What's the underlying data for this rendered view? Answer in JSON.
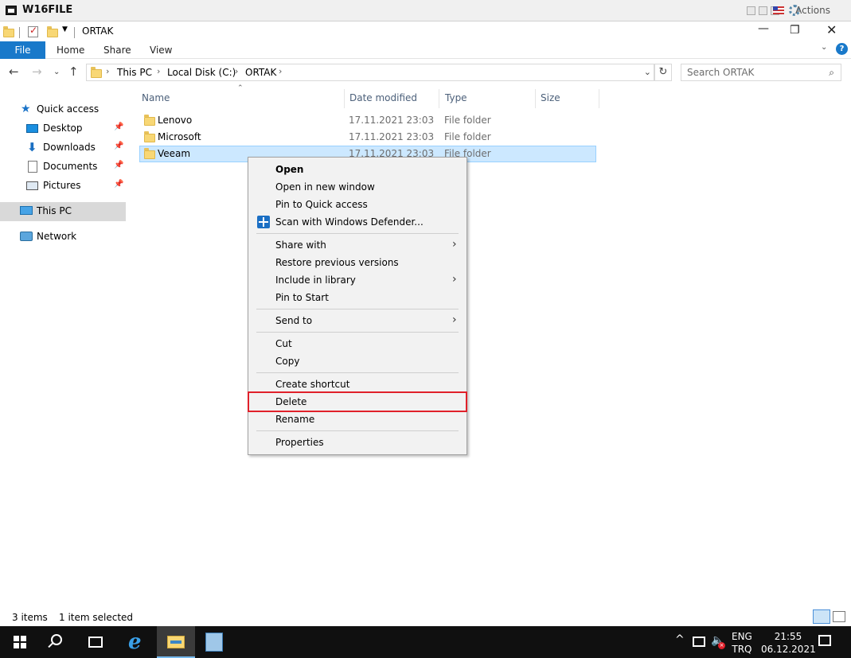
{
  "vm": {
    "title": "W16FILE",
    "actions_label": "Actions"
  },
  "window": {
    "title": "ORTAK"
  },
  "ribbon": {
    "tabs": [
      "File",
      "Home",
      "Share",
      "View"
    ]
  },
  "address": {
    "crumbs": [
      "This PC",
      "Local Disk (C:)",
      "ORTAK"
    ]
  },
  "search": {
    "placeholder": "Search ORTAK"
  },
  "sidebar": {
    "items": [
      {
        "label": "Quick access",
        "icon": "star-icon"
      },
      {
        "label": "Desktop",
        "icon": "desktop-icon",
        "pinned": true
      },
      {
        "label": "Downloads",
        "icon": "downloads-icon",
        "pinned": true
      },
      {
        "label": "Documents",
        "icon": "documents-icon",
        "pinned": true
      },
      {
        "label": "Pictures",
        "icon": "pictures-icon",
        "pinned": true
      },
      {
        "label": "This PC",
        "icon": "pc-icon",
        "selected": true
      },
      {
        "label": "Network",
        "icon": "network-icon"
      }
    ]
  },
  "list": {
    "columns": [
      "Name",
      "Date modified",
      "Type",
      "Size"
    ],
    "rows": [
      {
        "name": "Lenovo",
        "date": "17.11.2021 23:03",
        "type": "File folder"
      },
      {
        "name": "Microsoft",
        "date": "17.11.2021 23:03",
        "type": "File folder"
      },
      {
        "name": "Veeam",
        "date": "17.11.2021 23:03",
        "type": "File folder",
        "selected": true
      }
    ]
  },
  "context_menu": {
    "items": [
      {
        "label": "Open",
        "bold": true
      },
      {
        "label": "Open in new window"
      },
      {
        "label": "Pin to Quick access"
      },
      {
        "label": "Scan with Windows Defender...",
        "icon": "defender-shield-icon"
      },
      {
        "label": "Share with",
        "submenu": true
      },
      {
        "label": "Restore previous versions"
      },
      {
        "label": "Include in library",
        "submenu": true
      },
      {
        "label": "Pin to Start"
      },
      {
        "label": "Send to",
        "submenu": true
      },
      {
        "label": "Cut"
      },
      {
        "label": "Copy"
      },
      {
        "label": "Create shortcut"
      },
      {
        "label": "Delete",
        "highlighted": true
      },
      {
        "label": "Rename"
      },
      {
        "label": "Properties"
      }
    ]
  },
  "status": {
    "count": "3 items",
    "selection": "1 item selected"
  },
  "taskbar": {
    "lang_top": "ENG",
    "lang_bottom": "TRQ",
    "time": "21:55",
    "date": "06.12.2021"
  },
  "colors": {
    "accent": "#1979ca",
    "selection": "#cce8ff",
    "highlight_border": "#e0202a",
    "taskbar": "#101010"
  }
}
